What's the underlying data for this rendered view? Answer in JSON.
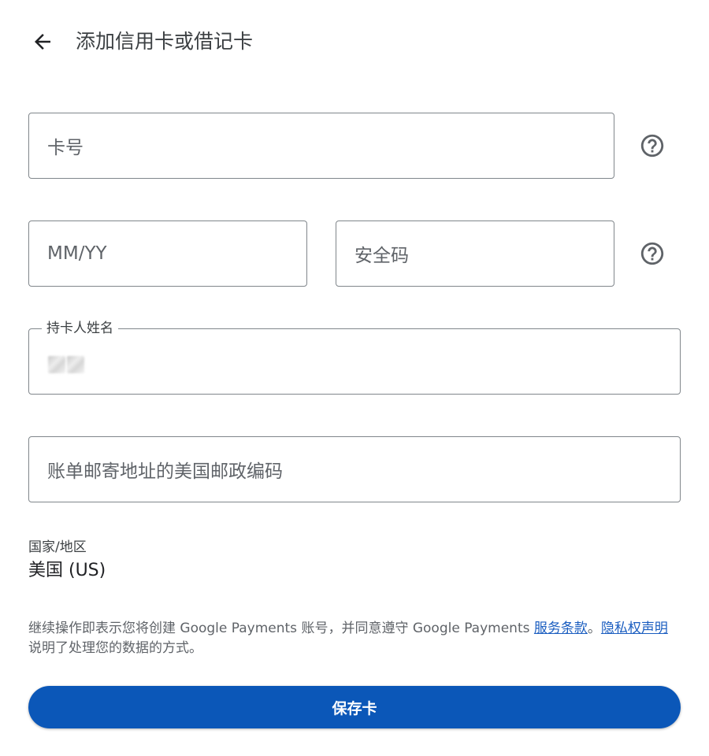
{
  "header": {
    "back_icon": "arrow-left-icon",
    "title": "添加信用卡或借记卡"
  },
  "form": {
    "card_number": {
      "placeholder": "卡号",
      "value": "",
      "help_icon": "help-circle-icon"
    },
    "expiry": {
      "placeholder": "MM/YY",
      "value": ""
    },
    "security_code": {
      "placeholder": "安全码",
      "value": "",
      "help_icon": "help-circle-icon"
    },
    "cardholder_name": {
      "label": "持卡人姓名",
      "value_redacted": true
    },
    "zip_code": {
      "placeholder": "账单邮寄地址的美国邮政编码",
      "value": ""
    }
  },
  "country": {
    "label": "国家/地区",
    "value": "美国 (US)"
  },
  "legal": {
    "text_before": "继续操作即表示您将创建 Google Payments 账号，并同意遵守 Google Payments ",
    "terms_link": "服务条款",
    "separator": "。",
    "privacy_link": "隐私权声明",
    "text_after": "说明了处理您的数据的方式。"
  },
  "actions": {
    "save_label": "保存卡"
  },
  "colors": {
    "primary_button": "#0b57b8",
    "link": "#1a5dc0",
    "border": "#80868b"
  }
}
